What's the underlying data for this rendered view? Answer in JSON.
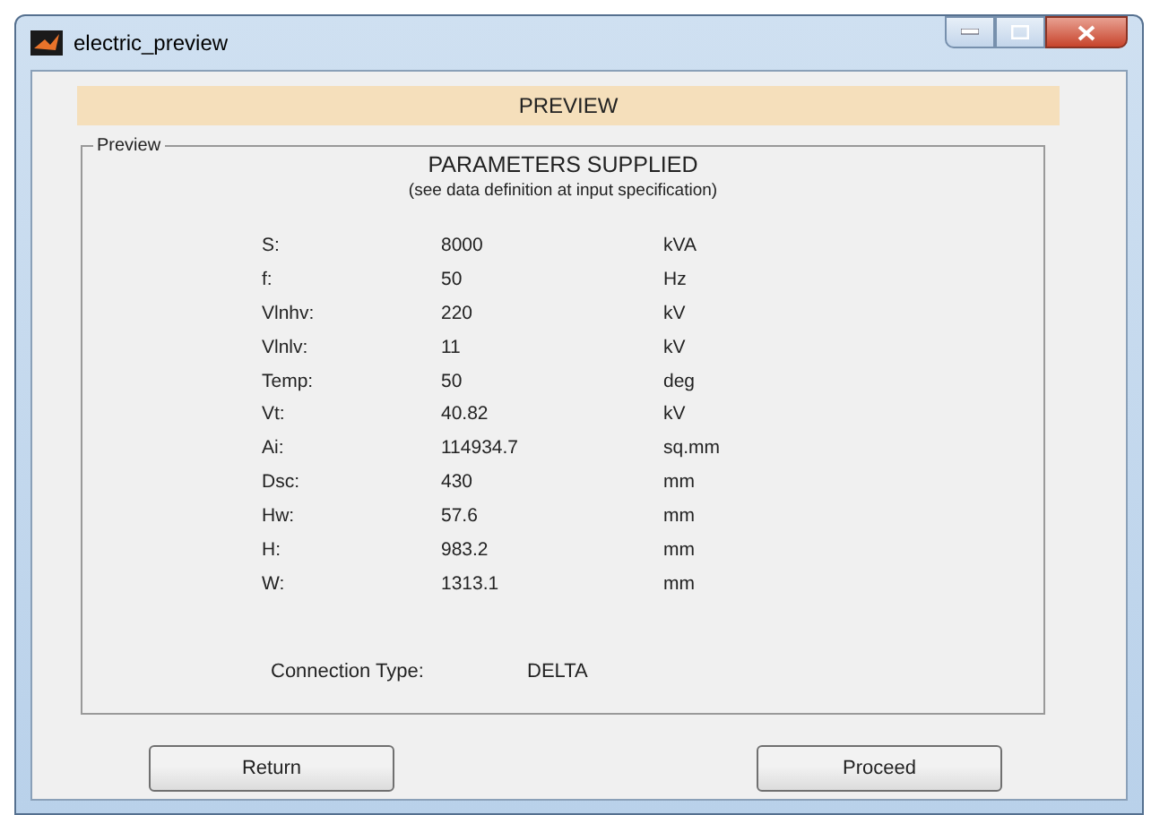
{
  "window": {
    "title": "electric_preview"
  },
  "banner": "PREVIEW",
  "panel": {
    "legend": "Preview",
    "heading": "PARAMETERS SUPPLIED",
    "subheading": "(see data definition at input specification)",
    "parameters": [
      {
        "label": "S:",
        "value": "8000",
        "unit": "kVA"
      },
      {
        "label": "f:",
        "value": "50",
        "unit": "Hz"
      },
      {
        "label": "Vlnhv:",
        "value": "220",
        "unit": "kV"
      },
      {
        "label": "Vlnlv:",
        "value": "11",
        "unit": "kV"
      },
      {
        "label": "Temp:",
        "value": "50",
        "unit": "deg"
      },
      {
        "label": "Vt:",
        "value": "40.82",
        "unit": "kV"
      },
      {
        "label": "Ai:",
        "value": "114934.7",
        "unit": "sq.mm"
      },
      {
        "label": "Dsc:",
        "value": "430",
        "unit": "mm"
      },
      {
        "label": "Hw:",
        "value": "57.6",
        "unit": "mm"
      },
      {
        "label": "H:",
        "value": "983.2",
        "unit": "mm"
      },
      {
        "label": "W:",
        "value": "1313.1",
        "unit": "mm"
      }
    ],
    "connection": {
      "label": "Connection Type:",
      "value": "DELTA"
    }
  },
  "buttons": [
    "Return",
    "Proceed"
  ]
}
